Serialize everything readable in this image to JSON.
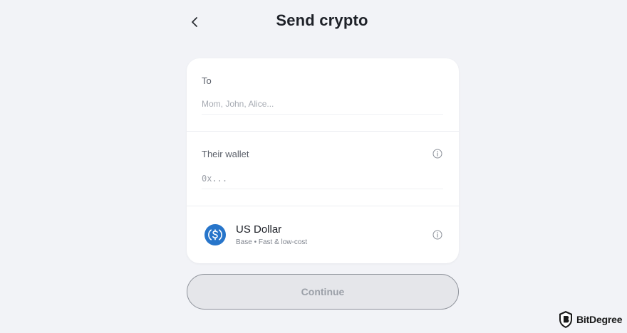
{
  "header": {
    "back_icon": "chevron-left-icon",
    "title": "Send crypto"
  },
  "form": {
    "to": {
      "label": "To",
      "placeholder": "Mom, John, Alice..."
    },
    "wallet": {
      "label": "Their wallet",
      "placeholder": "0x...",
      "info_icon": "info-icon"
    },
    "asset": {
      "name": "US Dollar",
      "subtitle": "Base • Fast & low-cost",
      "icon": "usdc-coin-icon",
      "info_icon": "info-icon"
    }
  },
  "actions": {
    "continue_label": "Continue"
  },
  "watermark": {
    "text": "BitDegree"
  },
  "colors": {
    "background": "#f2f3f7",
    "card": "#ffffff",
    "usdc_blue": "#2775ca",
    "button_disabled_bg": "#e5e6ea",
    "button_disabled_text": "#9ba0a8"
  }
}
